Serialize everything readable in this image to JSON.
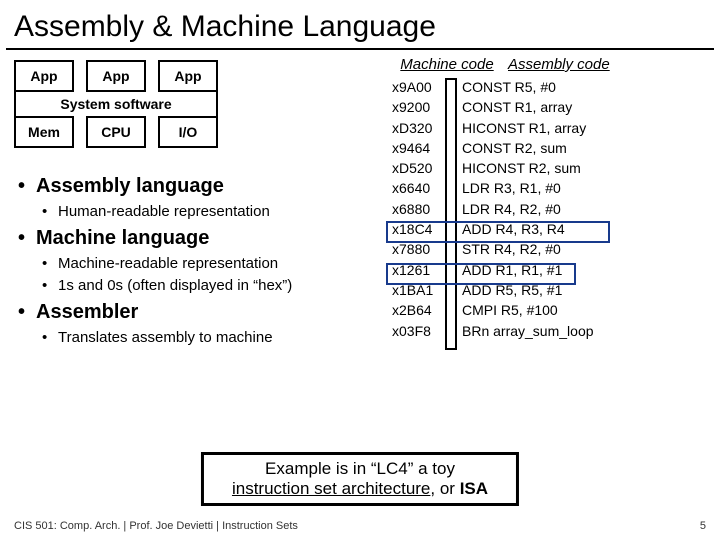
{
  "title": "Assembly & Machine Language",
  "layers": {
    "app": "App",
    "sys": "System software",
    "mem": "Mem",
    "cpu": "CPU",
    "io": "I/O"
  },
  "bullets": {
    "b1": "Assembly language",
    "b1a": "Human-readable representation",
    "b2": "Machine language",
    "b2a": "Machine-readable representation",
    "b2b": "1s and 0s (often displayed in “hex”)",
    "b3": "Assembler",
    "b3a": "Translates assembly to machine"
  },
  "headers": {
    "mc": "Machine code",
    "ac": "Assembly code"
  },
  "code": [
    {
      "mc": "x9A00",
      "ac": "CONST R5, #0"
    },
    {
      "mc": "x9200",
      "ac": "CONST R1, array"
    },
    {
      "mc": "xD320",
      "ac": "HICONST R1, array"
    },
    {
      "mc": "x9464",
      "ac": "CONST R2, sum"
    },
    {
      "mc": "xD520",
      "ac": "HICONST R2, sum"
    },
    {
      "mc": "x6640",
      "ac": "LDR R3, R1, #0"
    },
    {
      "mc": "x6880",
      "ac": "LDR R4, R2, #0"
    },
    {
      "mc": "x18C4",
      "ac": "ADD R4, R3, R4"
    },
    {
      "mc": "x7880",
      "ac": "STR R4, R2, #0"
    },
    {
      "mc": "x1261",
      "ac": "ADD R1, R1, #1"
    },
    {
      "mc": "x1BA1",
      "ac": "ADD R5, R5, #1"
    },
    {
      "mc": "x2B64",
      "ac": "CMPI R5, #100"
    },
    {
      "mc": "x03F8",
      "ac": "BRn array_sum_loop"
    }
  ],
  "example": {
    "l1a": "Example is in “LC4” a toy",
    "l2a": "instruction set architecture",
    "l2b": ", or ",
    "l2c": "ISA"
  },
  "footer": {
    "left": "CIS 501: Comp. Arch.  |  Prof. Joe Devietti  |  Instruction Sets",
    "right": "5"
  }
}
